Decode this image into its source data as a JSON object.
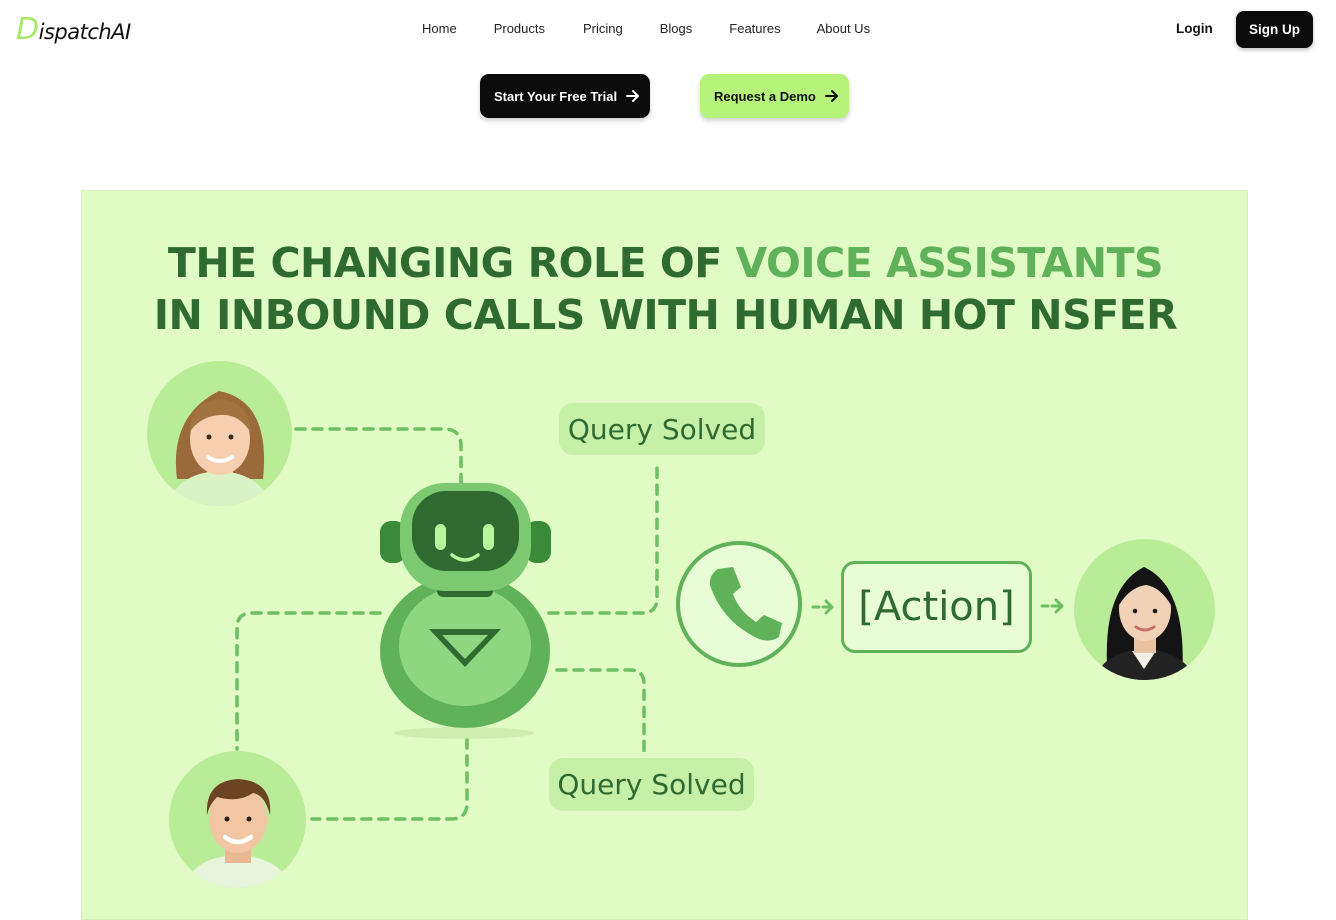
{
  "brand": {
    "logo_initial": "D",
    "logo_rest": "ispatchAI",
    "accent": "#a8e86a"
  },
  "nav": {
    "links": [
      "Home",
      "Products",
      "Pricing",
      "Blogs",
      "Features",
      "About Us"
    ],
    "login": "Login",
    "signup": "Sign Up"
  },
  "cta": {
    "trial": "Start Your Free Trial",
    "demo": "Request a Demo",
    "demo_color": "#b5f37a"
  },
  "hero": {
    "title_line1_plain": "THE CHANGING ROLE OF ",
    "title_line1_accent": "VOICE ASSISTANTS",
    "title_line2": "IN INBOUND CALLS WITH HUMAN HOT NSFER",
    "query_solved_top": "Query Solved",
    "query_solved_bottom": "Query Solved",
    "action": "[Action]",
    "background": "#e1fbc4",
    "dark_green": "#2f6b30",
    "accent_green": "#5fb15a"
  }
}
